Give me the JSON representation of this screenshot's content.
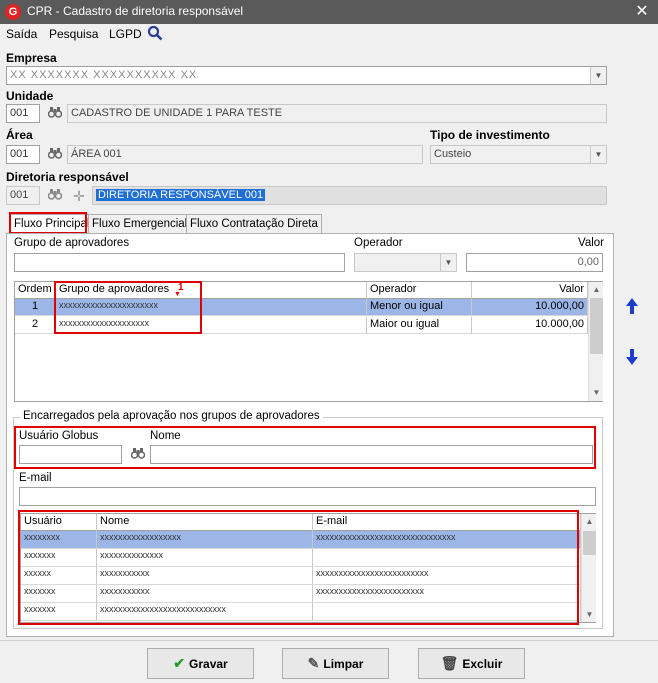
{
  "window": {
    "title": "CPR - Cadastro de diretoria responsável",
    "close_glyph": "✕",
    "icon_letter": "G"
  },
  "menu": {
    "items": [
      "Saída",
      "Pesquisa",
      "LGPD"
    ]
  },
  "empresa": {
    "label": "Empresa",
    "value": "XX XXXXXXX XXXXXXXXXX XX",
    "placeholder_blur": true
  },
  "unidade": {
    "label": "Unidade",
    "code": "001",
    "name": "CADASTRO DE UNIDADE 1 PARA TESTE"
  },
  "area": {
    "label": "Área",
    "code": "001",
    "name": "ÁREA 001"
  },
  "tipo_investimento": {
    "label": "Tipo de investimento",
    "value": "Custeio"
  },
  "diretoria": {
    "label": "Diretoria responsável",
    "code": "001",
    "name": "DIRETORIA RESPONSÁVEL 001"
  },
  "tabs": [
    {
      "label": "Fluxo Principal",
      "active": true
    },
    {
      "label": "Fluxo Emergencial",
      "active": false
    },
    {
      "label": "Fluxo Contratação Direta",
      "active": false
    }
  ],
  "filters": {
    "grupo_label": "Grupo de aprovadores",
    "operador_label": "Operador",
    "valor_label": "Valor",
    "valor_value": "0,00"
  },
  "grupos_table": {
    "columns": [
      "Ordem",
      "Grupo de aprovadores",
      "Operador",
      "Valor"
    ],
    "annotation": "1",
    "rows": [
      {
        "ordem": "1",
        "grupo": "xxxxxxxxxxxxxxxxxxxxxx",
        "operador": "Menor ou igual",
        "valor": "10.000,00",
        "selected": true
      },
      {
        "ordem": "2",
        "grupo": "xxxxxxxxxxxxxxxxxxxx",
        "operador": "Maior ou igual",
        "valor": "10.000,00",
        "selected": false
      }
    ]
  },
  "encarregados": {
    "group_label": "Encarregados pela aprovação nos grupos de aprovadores",
    "usuario_label": "Usuário Globus",
    "nome_label": "Nome",
    "email_label": "E-mail",
    "columns": [
      "Usuário",
      "Nome",
      "E-mail"
    ],
    "rows": [
      {
        "usuario": "xxxxxxxx",
        "nome": "xxxxxxxxxxxxxxxxxx",
        "email": "xxxxxxxxxxxxxxxxxxxxxxxxxxxxxxx",
        "selected": true
      },
      {
        "usuario": "xxxxxxx",
        "nome": "xxxxxxxxxxxxxx",
        "email": "",
        "selected": false
      },
      {
        "usuario": "xxxxxx",
        "nome": "xxxxxxxxxxx",
        "email": "xxxxxxxxxxxxxxxxxxxxxxxxx",
        "selected": false
      },
      {
        "usuario": "xxxxxxx",
        "nome": "xxxxxxxxxxx",
        "email": "xxxxxxxxxxxxxxxxxxxxxxxx",
        "selected": false
      },
      {
        "usuario": "xxxxxxx",
        "nome": "xxxxxxxxxxxxxxxxxxxxxxxxxxxx",
        "email": "",
        "selected": false
      }
    ]
  },
  "buttons": {
    "gravar": "Gravar",
    "limpar": "Limpar",
    "excluir": "Excluir"
  },
  "colors": {
    "highlight_red": "#e00000",
    "selection_blue": "#9cb6e8",
    "arrow_blue": "#1c3fc8"
  }
}
